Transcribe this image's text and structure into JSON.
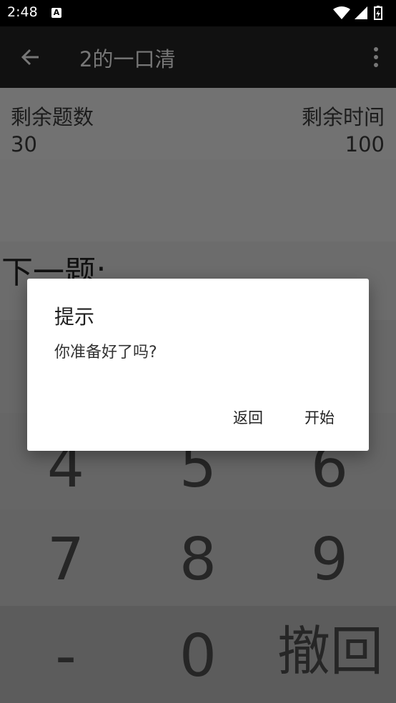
{
  "status_bar": {
    "time": "2:48",
    "notification_icon": "A"
  },
  "app_bar": {
    "title": "2的一口清"
  },
  "stats": {
    "remaining_questions_label": "剩余题数",
    "remaining_questions_value": "30",
    "remaining_time_label": "剩余时间",
    "remaining_time_value": "100"
  },
  "question": {
    "label": "下一题:"
  },
  "keypad": {
    "k4": "4",
    "k5": "5",
    "k6": "6",
    "k7": "7",
    "k8": "8",
    "k9": "9",
    "minus": "-",
    "k0": "0",
    "undo": "撤回"
  },
  "dialog": {
    "title": "提示",
    "message": "你准备好了吗?",
    "return_label": "返回",
    "start_label": "开始"
  }
}
